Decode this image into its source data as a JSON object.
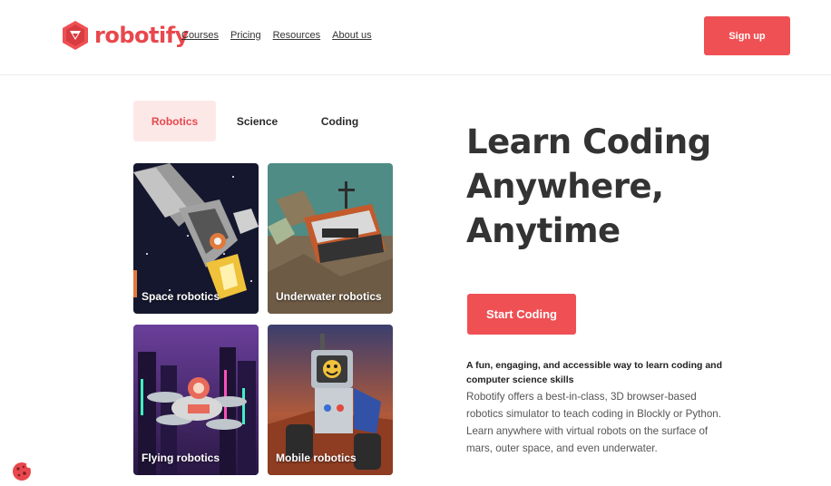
{
  "brand": {
    "name": "robotify",
    "accent": "#ef5054",
    "accent_light": "#fde8e8"
  },
  "nav": {
    "items": [
      "Courses",
      "Pricing",
      "Resources",
      "About us"
    ]
  },
  "header": {
    "signup_label": "Sign up"
  },
  "tabs": [
    {
      "label": "Robotics",
      "active": true
    },
    {
      "label": "Science",
      "active": false
    },
    {
      "label": "Coding",
      "active": false
    }
  ],
  "cards": [
    {
      "label": "Space robotics",
      "icon": "space-robot-image"
    },
    {
      "label": "Underwater robotics",
      "icon": "underwater-robot-image"
    },
    {
      "label": "Flying robotics",
      "icon": "drone-robot-image"
    },
    {
      "label": "Mobile robotics",
      "icon": "mars-rover-image"
    }
  ],
  "hero": {
    "title_lines": [
      "Learn Coding",
      "Anywhere,",
      "Anytime"
    ],
    "cta_label": "Start Coding",
    "tagline": "A fun, engaging, and accessible way to learn coding and computer science skills",
    "description": "Robotify offers a best-in-class, 3D browser-based robotics simulator to teach coding in Blockly or Python. Learn anywhere with virtual robots on the surface of mars, outer space, and even underwater."
  },
  "cookie": {
    "icon": "cookie-icon"
  }
}
